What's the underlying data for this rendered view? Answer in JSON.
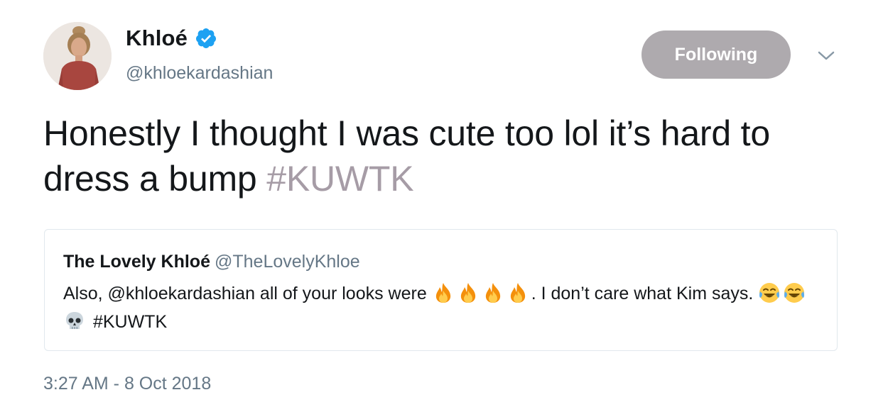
{
  "tweet": {
    "author": {
      "display_name": "Khloé",
      "handle": "@khloekardashian",
      "verified": true,
      "avatar_icon": "profile-photo"
    },
    "follow_button_label": "Following",
    "text_main": "Honestly I thought I was cute too lol it’s hard to dress a bump ",
    "hashtag": "#KUWTK",
    "timestamp": "3:27 AM - 8 Oct 2018",
    "colors": {
      "hashtag": "#a69ca6",
      "follow_button": "#aeaaae",
      "verified_badge": "#1da1f2",
      "secondary_text": "#657786"
    }
  },
  "quote": {
    "display_name": "The Lovely Khloé",
    "handle": "@TheLovelyKhloe",
    "text_part1": "Also, @khloekardashian all of your looks were ",
    "text_part2": ". I don’t care what Kim says. ",
    "hashtag": "#KUWTK",
    "emojis_first": [
      "fire-emoji",
      "fire-emoji",
      "fire-emoji",
      "fire-emoji"
    ],
    "emojis_second": [
      "tears-of-joy-emoji",
      "tears-of-joy-emoji",
      "skull-emoji"
    ]
  }
}
